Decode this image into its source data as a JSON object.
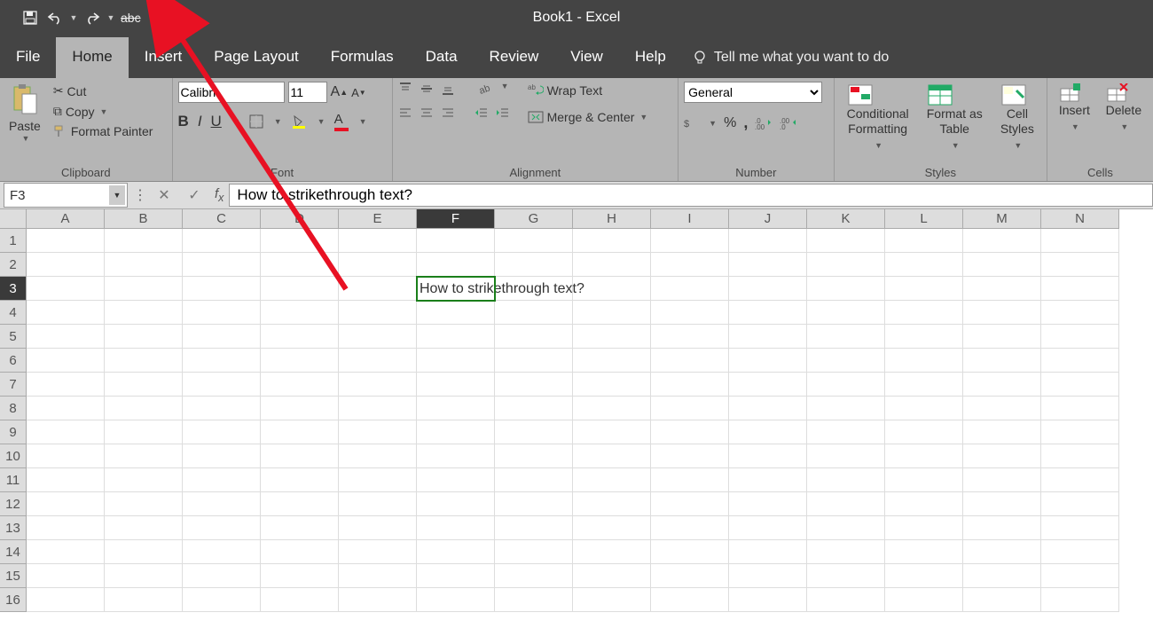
{
  "title": "Book1  -  Excel",
  "qat": {
    "strikethrough_label": "abc"
  },
  "tabs": [
    "File",
    "Home",
    "Insert",
    "Page Layout",
    "Formulas",
    "Data",
    "Review",
    "View",
    "Help"
  ],
  "active_tab": "Home",
  "tellme": "Tell me what you want to do",
  "clipboard": {
    "paste": "Paste",
    "cut": "Cut",
    "copy": "Copy",
    "format_painter": "Format Painter",
    "group": "Clipboard"
  },
  "font": {
    "name": "Calibri",
    "size": "11",
    "group": "Font"
  },
  "alignment": {
    "wrap": "Wrap Text",
    "merge": "Merge & Center",
    "group": "Alignment"
  },
  "number": {
    "format": "General",
    "group": "Number"
  },
  "styles": {
    "conditional": "Conditional\nFormatting",
    "format_as": "Format as\nTable",
    "cell_styles": "Cell\nStyles",
    "group": "Styles"
  },
  "cells": {
    "insert": "Insert",
    "delete": "Delete",
    "group": "Cells"
  },
  "namebox": "F3",
  "formula": "How to strikethrough text?",
  "columns": [
    "A",
    "B",
    "C",
    "D",
    "E",
    "F",
    "G",
    "H",
    "I",
    "J",
    "K",
    "L",
    "M",
    "N"
  ],
  "rows": [
    "1",
    "2",
    "3",
    "4",
    "5",
    "6",
    "7",
    "8",
    "9",
    "10",
    "11",
    "12",
    "13",
    "14",
    "15",
    "16"
  ],
  "active_col": "F",
  "active_row": "3",
  "cell_content": {
    "F3": "How to strikethrough text?"
  }
}
